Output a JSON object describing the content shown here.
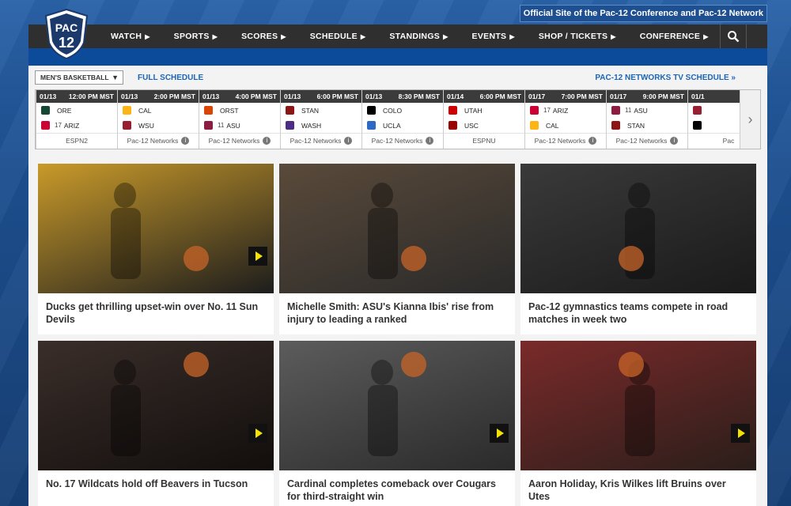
{
  "official_link": "Official Site of the Pac-12 Conference and Pac-12 Network",
  "logo": {
    "text": "PAC 12"
  },
  "nav": [
    {
      "label": "WATCH"
    },
    {
      "label": "SPORTS"
    },
    {
      "label": "SCORES"
    },
    {
      "label": "SCHEDULE"
    },
    {
      "label": "STANDINGS"
    },
    {
      "label": "EVENTS"
    },
    {
      "label": "SHOP / TICKETS"
    },
    {
      "label": "CONFERENCE"
    }
  ],
  "scoreboard": {
    "sport_select": "MEN'S BASKETBALL",
    "full_schedule": "FULL SCHEDULE",
    "tv_schedule": "PAC-12 NETWORKS TV SCHEDULE »",
    "games": [
      {
        "date": "01/13",
        "time": "12:00 PM MST",
        "t1": "ORE",
        "r1": "",
        "c1": "#154733",
        "t2": "ARIZ",
        "r2": "17",
        "c2": "#cc0033",
        "net": "ESPN2",
        "info": false
      },
      {
        "date": "01/13",
        "time": "2:00 PM MST",
        "t1": "CAL",
        "r1": "",
        "c1": "#fdb515",
        "t2": "WSU",
        "r2": "",
        "c2": "#981e32",
        "net": "Pac-12 Networks",
        "info": true
      },
      {
        "date": "01/13",
        "time": "4:00 PM MST",
        "t1": "ORST",
        "r1": "",
        "c1": "#dc4405",
        "t2": "ASU",
        "r2": "11",
        "c2": "#8c1d40",
        "net": "Pac-12 Networks",
        "info": true
      },
      {
        "date": "01/13",
        "time": "6:00 PM MST",
        "t1": "STAN",
        "r1": "",
        "c1": "#8c1515",
        "t2": "WASH",
        "r2": "",
        "c2": "#4b2e83",
        "net": "Pac-12 Networks",
        "info": true
      },
      {
        "date": "01/13",
        "time": "8:30 PM MST",
        "t1": "COLO",
        "r1": "",
        "c1": "#000000",
        "t2": "UCLA",
        "r2": "",
        "c2": "#2d68c4",
        "net": "Pac-12 Networks",
        "info": true
      },
      {
        "date": "01/14",
        "time": "6:00 PM MST",
        "t1": "UTAH",
        "r1": "",
        "c1": "#cc0000",
        "t2": "USC",
        "r2": "",
        "c2": "#990000",
        "net": "ESPNU",
        "info": false
      },
      {
        "date": "01/17",
        "time": "7:00 PM MST",
        "t1": "ARIZ",
        "r1": "17",
        "c1": "#cc0033",
        "t2": "CAL",
        "r2": "",
        "c2": "#fdb515",
        "net": "Pac-12 Networks",
        "info": true
      },
      {
        "date": "01/17",
        "time": "9:00 PM MST",
        "t1": "ASU",
        "r1": "11",
        "c1": "#8c1d40",
        "t2": "STAN",
        "r2": "",
        "c2": "#8c1515",
        "net": "Pac-12 Networks",
        "info": true
      },
      {
        "date": "01/1",
        "time": "",
        "t1": "",
        "r1": "",
        "c1": "#981e32",
        "t2": "",
        "r2": "",
        "c2": "#000000",
        "net": "Pac",
        "info": false
      }
    ]
  },
  "cards": [
    {
      "caption": "Ducks get thrilling upset-win over No. 11 Sun Devils",
      "video": true,
      "palette": [
        "#c99a2a",
        "#1d1d1d"
      ]
    },
    {
      "caption": "Michelle Smith: ASU's Kianna Ibis' rise from injury to leading a ranked",
      "video": false,
      "palette": [
        "#5a4a3a",
        "#2a2a2a"
      ]
    },
    {
      "caption": "Pac-12 gymnastics teams compete in road matches in week two",
      "video": false,
      "palette": [
        "#3a3a3a",
        "#1a1a1a"
      ]
    },
    {
      "caption": "No. 17 Wildcats hold off Beavers in Tucson",
      "video": true,
      "palette": [
        "#3a2e2a",
        "#120e0c"
      ]
    },
    {
      "caption": "Cardinal completes comeback over Cougars for third-straight win",
      "video": true,
      "palette": [
        "#5c5c5c",
        "#2a2a2a"
      ]
    },
    {
      "caption": "Aaron Holiday, Kris Wilkes lift Bruins over Utes",
      "video": true,
      "palette": [
        "#7a2a2a",
        "#2a1e1a"
      ]
    }
  ]
}
